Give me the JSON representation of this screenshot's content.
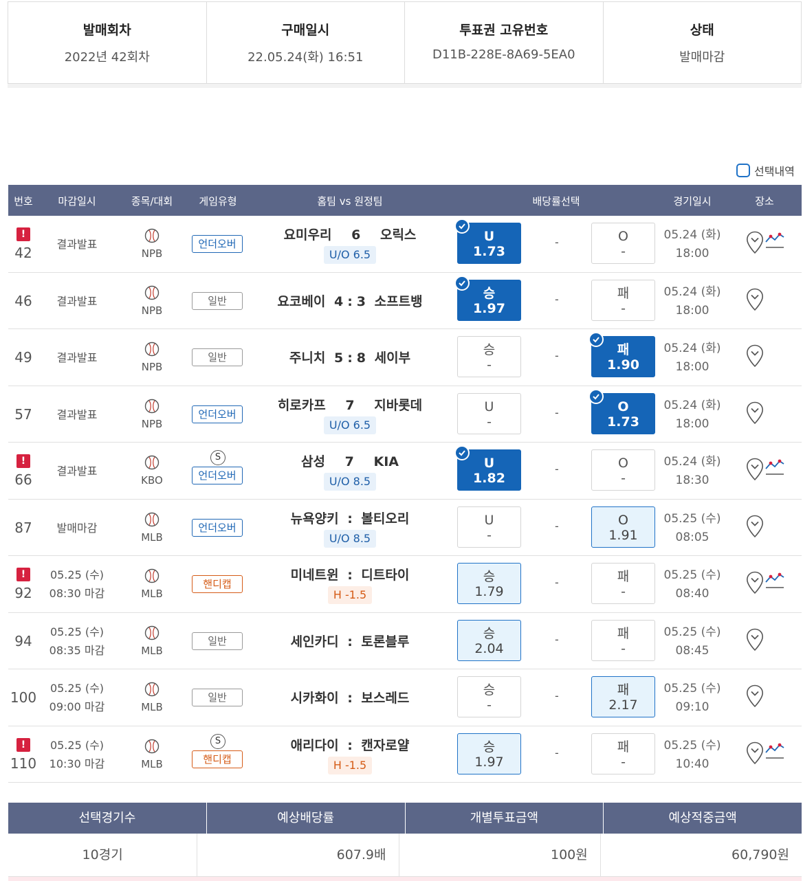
{
  "summary": {
    "round_label": "발매회차",
    "round_value": "2022년 42회차",
    "purchase_label": "구매일시",
    "purchase_value": "22.05.24(화) 16:51",
    "ticket_label": "투표권 고유번호",
    "ticket_value": "D11B-228E-8A69-5EA0",
    "status_label": "상태",
    "status_value": "발매마감"
  },
  "selection_toggle_label": "선택내역",
  "table_headers": {
    "no": "번호",
    "deadline": "마감일시",
    "sport": "종목/대회",
    "game_type": "게임유형",
    "match": "홈팀 vs 원정팀",
    "odds": "배당률선택",
    "game_date": "경기일시",
    "place": "장소"
  },
  "games": [
    {
      "no": "42",
      "alert": "!",
      "deadline": [
        "결과발표"
      ],
      "league": "NPB",
      "special": "",
      "game_type": "언더오버",
      "type_class": "uo",
      "home": "요미우리",
      "score": "6",
      "sep": "",
      "away": "오릭스",
      "handicap": "U/O 6.5",
      "home_odd": {
        "label": "U",
        "value": "1.73",
        "state": "picked"
      },
      "draw": "-",
      "away_odd": {
        "label": "O",
        "value": "-",
        "state": "none"
      },
      "date": "05.24 (화)",
      "time": "18:00",
      "chart": true
    },
    {
      "no": "46",
      "alert": "",
      "deadline": [
        "결과발표"
      ],
      "league": "NPB",
      "special": "",
      "game_type": "일반",
      "type_class": "gen",
      "home": "요코베이",
      "score": "4",
      "sep": ":",
      "score2": "3",
      "away": "소프트뱅",
      "handicap": "",
      "home_odd": {
        "label": "승",
        "value": "1.97",
        "state": "picked"
      },
      "draw": "-",
      "away_odd": {
        "label": "패",
        "value": "-",
        "state": "none"
      },
      "date": "05.24 (화)",
      "time": "18:00",
      "chart": false
    },
    {
      "no": "49",
      "alert": "",
      "deadline": [
        "결과발표"
      ],
      "league": "NPB",
      "special": "",
      "game_type": "일반",
      "type_class": "gen",
      "home": "주니치",
      "score": "5",
      "sep": ":",
      "score2": "8",
      "away": "세이부",
      "handicap": "",
      "home_odd": {
        "label": "승",
        "value": "-",
        "state": "none"
      },
      "draw": "-",
      "away_odd": {
        "label": "패",
        "value": "1.90",
        "state": "picked"
      },
      "date": "05.24 (화)",
      "time": "18:00",
      "chart": false
    },
    {
      "no": "57",
      "alert": "",
      "deadline": [
        "결과발표"
      ],
      "league": "NPB",
      "special": "",
      "game_type": "언더오버",
      "type_class": "uo",
      "home": "히로카프",
      "score": "7",
      "sep": "",
      "away": "지바롯데",
      "handicap": "U/O 6.5",
      "home_odd": {
        "label": "U",
        "value": "-",
        "state": "none"
      },
      "draw": "-",
      "away_odd": {
        "label": "O",
        "value": "1.73",
        "state": "picked"
      },
      "date": "05.24 (화)",
      "time": "18:00",
      "chart": false
    },
    {
      "no": "66",
      "alert": "!",
      "deadline": [
        "결과발표"
      ],
      "league": "KBO",
      "special": "S",
      "game_type": "언더오버",
      "type_class": "uo",
      "home": "삼성",
      "score": "7",
      "sep": "",
      "away": "KIA",
      "handicap": "U/O 8.5",
      "home_odd": {
        "label": "U",
        "value": "1.82",
        "state": "picked"
      },
      "draw": "-",
      "away_odd": {
        "label": "O",
        "value": "-",
        "state": "none"
      },
      "date": "05.24 (화)",
      "time": "18:30",
      "chart": true
    },
    {
      "no": "87",
      "alert": "",
      "deadline": [
        "발매마감"
      ],
      "league": "MLB",
      "special": "",
      "game_type": "언더오버",
      "type_class": "uo",
      "home": "뉴욕양키",
      "score": "",
      "sep": ":",
      "away": "볼티오리",
      "handicap": "U/O 8.5",
      "home_odd": {
        "label": "U",
        "value": "-",
        "state": "none"
      },
      "draw": "-",
      "away_odd": {
        "label": "O",
        "value": "1.91",
        "state": "avail"
      },
      "date": "05.25 (수)",
      "time": "08:05",
      "chart": false
    },
    {
      "no": "92",
      "alert": "!",
      "deadline": [
        "05.25 (수)",
        "08:30 마감"
      ],
      "league": "MLB",
      "special": "",
      "game_type": "핸디캡",
      "type_class": "hc",
      "home": "미네트윈",
      "score": "",
      "sep": ":",
      "away": "디트타이",
      "handicap": "H -1.5",
      "home_odd": {
        "label": "승",
        "value": "1.79",
        "state": "avail"
      },
      "draw": "-",
      "away_odd": {
        "label": "패",
        "value": "-",
        "state": "none"
      },
      "date": "05.25 (수)",
      "time": "08:40",
      "chart": true
    },
    {
      "no": "94",
      "alert": "",
      "deadline": [
        "05.25 (수)",
        "08:35 마감"
      ],
      "league": "MLB",
      "special": "",
      "game_type": "일반",
      "type_class": "gen",
      "home": "세인카디",
      "score": "",
      "sep": ":",
      "away": "토론블루",
      "handicap": "",
      "home_odd": {
        "label": "승",
        "value": "2.04",
        "state": "avail"
      },
      "draw": "-",
      "away_odd": {
        "label": "패",
        "value": "-",
        "state": "none"
      },
      "date": "05.25 (수)",
      "time": "08:45",
      "chart": false
    },
    {
      "no": "100",
      "alert": "",
      "deadline": [
        "05.25 (수)",
        "09:00 마감"
      ],
      "league": "MLB",
      "special": "",
      "game_type": "일반",
      "type_class": "gen",
      "home": "시카화이",
      "score": "",
      "sep": ":",
      "away": "보스레드",
      "handicap": "",
      "home_odd": {
        "label": "승",
        "value": "-",
        "state": "none"
      },
      "draw": "-",
      "away_odd": {
        "label": "패",
        "value": "2.17",
        "state": "avail"
      },
      "date": "05.25 (수)",
      "time": "09:10",
      "chart": false
    },
    {
      "no": "110",
      "alert": "!",
      "deadline": [
        "05.25 (수)",
        "10:30 마감"
      ],
      "league": "MLB",
      "special": "S",
      "game_type": "핸디캡",
      "type_class": "hc",
      "home": "애리다이",
      "score": "",
      "sep": ":",
      "away": "캔자로얄",
      "handicap": "H -1.5",
      "home_odd": {
        "label": "승",
        "value": "1.97",
        "state": "avail"
      },
      "draw": "-",
      "away_odd": {
        "label": "패",
        "value": "-",
        "state": "none"
      },
      "date": "05.25 (수)",
      "time": "10:40",
      "chart": true
    }
  ],
  "totals": {
    "count_label": "선택경기수",
    "count_value": "10경기",
    "rate_label": "예상배당률",
    "rate_value": "607.9배",
    "stake_label": "개별투표금액",
    "stake_value": "100원",
    "payout_label": "예상적중금액",
    "payout_value": "60,790원"
  },
  "colors": {
    "header_bg": "#5b6688",
    "picked": "#1565b7",
    "available": "#e6f3fc",
    "alert": "#d6213f",
    "handicap": "#d55b16"
  }
}
